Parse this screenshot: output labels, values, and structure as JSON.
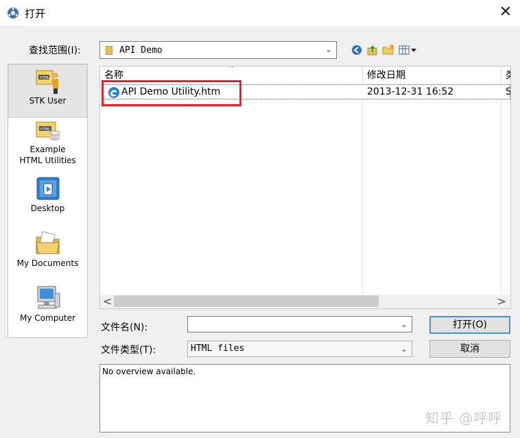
{
  "window": {
    "title": "打开",
    "close_glyph": "✕"
  },
  "lookin": {
    "label": "查找范围(I):",
    "value": "API Demo",
    "arrow": "⌄"
  },
  "places": [
    {
      "label_lines": [
        "STK User"
      ],
      "icon": "stk-user-icon"
    },
    {
      "label_lines": [
        "Example",
        "HTML Utilities"
      ],
      "icon": "html-utilities-icon"
    },
    {
      "label_lines": [
        "Desktop"
      ],
      "icon": "desktop-icon"
    },
    {
      "label_lines": [
        "My Documents"
      ],
      "icon": "my-documents-icon"
    },
    {
      "label_lines": [
        "My Computer"
      ],
      "icon": "my-computer-icon"
    }
  ],
  "filelist": {
    "columns": [
      "名称",
      "修改日期",
      "类"
    ],
    "rows": [
      {
        "name": "API Demo Utility.htm",
        "modified": "2013-12-31 16:52",
        "type": "S"
      }
    ]
  },
  "scrollbar": {
    "left": "<",
    "right": ">"
  },
  "filename": {
    "label": "文件名(N):",
    "value": "",
    "arrow": "⌄"
  },
  "filetype": {
    "label": "文件类型(T):",
    "value": "HTML files",
    "arrow": "⌄"
  },
  "buttons": {
    "open": "打开(O)",
    "cancel": "取消"
  },
  "overview": {
    "text": "No overview available."
  },
  "watermark": "知乎 @呼呼",
  "colors": {
    "highlight": "#e3222b",
    "default_button_border": "#4a90d9"
  }
}
